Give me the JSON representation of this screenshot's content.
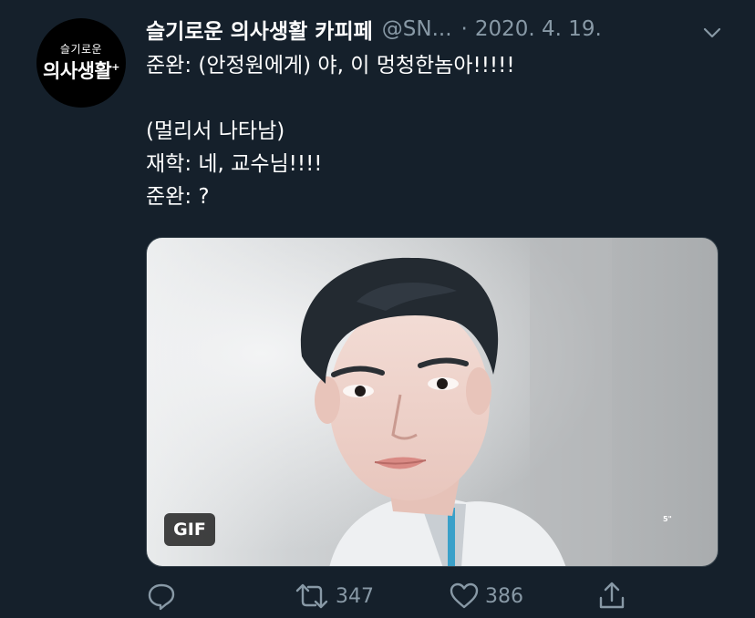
{
  "account": {
    "avatar_small_text": "슬기로운",
    "avatar_big_text": "의사생활",
    "avatar_plus": "+",
    "display_name": "슬기로운 의사생활 카피페",
    "handle": "@SN...",
    "separator": "·",
    "date": "2020. 4. 19."
  },
  "tweet": {
    "lines": [
      "준완: (안정원에게) 야, 이 멍청한놈아!!!!!",
      "",
      "(멀리서 나타남)",
      "재학: 네, 교수님!!!!",
      "준완: ?"
    ]
  },
  "media": {
    "badge": "GIF",
    "watermark": "5\""
  },
  "actions": {
    "reply_icon": "reply-icon",
    "retweet_icon": "retweet-icon",
    "retweet_count": "347",
    "like_icon": "heart-icon",
    "like_count": "386",
    "share_icon": "share-icon"
  },
  "colors": {
    "background": "#15202b",
    "secondary_text": "#8899a6",
    "primary_text": "#ffffff"
  }
}
